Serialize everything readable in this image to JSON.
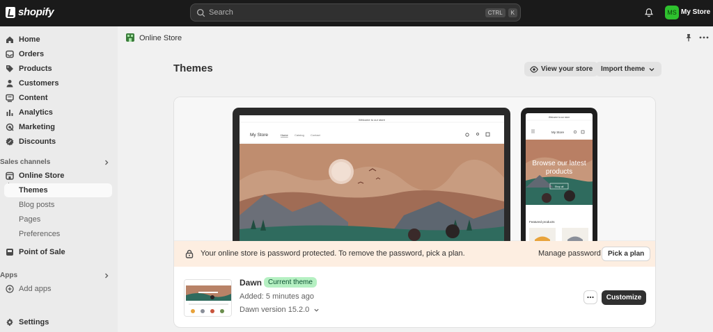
{
  "topbar": {
    "logo_text": "shopify",
    "search_placeholder": "Search",
    "shortcut_keys": [
      "CTRL",
      "K"
    ],
    "avatar_initials": "MS",
    "store_name": "My Store",
    "colors": {
      "bar": "#1a1a1a",
      "avatar": "#2ec12e"
    }
  },
  "sidebar": {
    "items": [
      {
        "label": "Home",
        "icon": "home-icon"
      },
      {
        "label": "Orders",
        "icon": "inbox-icon"
      },
      {
        "label": "Products",
        "icon": "tag-icon"
      },
      {
        "label": "Customers",
        "icon": "person-icon"
      },
      {
        "label": "Content",
        "icon": "content-icon"
      },
      {
        "label": "Analytics",
        "icon": "bar-chart-icon"
      },
      {
        "label": "Marketing",
        "icon": "target-icon"
      },
      {
        "label": "Discounts",
        "icon": "discount-icon"
      }
    ],
    "sales_channels_header": "Sales channels",
    "online_store": "Online Store",
    "online_store_sub": [
      "Themes",
      "Blog posts",
      "Pages",
      "Preferences"
    ],
    "point_of_sale": "Point of Sale",
    "apps_header": "Apps",
    "add_apps": "Add apps",
    "settings": "Settings"
  },
  "main": {
    "breadcrumb": "Online Store",
    "page_title": "Themes",
    "view_store_label": "View your store",
    "import_theme_label": "Import theme",
    "preview": {
      "desktop": {
        "announcement": "Welcome to our store",
        "store_name": "My Store",
        "nav": [
          "Home",
          "Catalog",
          "Contact"
        ]
      },
      "mobile": {
        "announcement": "Welcome to our store",
        "store_name": "My Store",
        "hero_text": "Browse our latest products",
        "hero_button": "Shop all",
        "featured": "Featured products"
      }
    },
    "banner": {
      "message": "Your online store is password protected. To remove the password, pick a plan.",
      "manage_label": "Manage password",
      "pick_plan_label": "Pick a plan",
      "color": "#fdeee1"
    },
    "theme": {
      "name": "Dawn",
      "badge": "Current theme",
      "added": "Added: 5 minutes ago",
      "version": "Dawn version 15.2.0",
      "customize_label": "Customize"
    }
  }
}
